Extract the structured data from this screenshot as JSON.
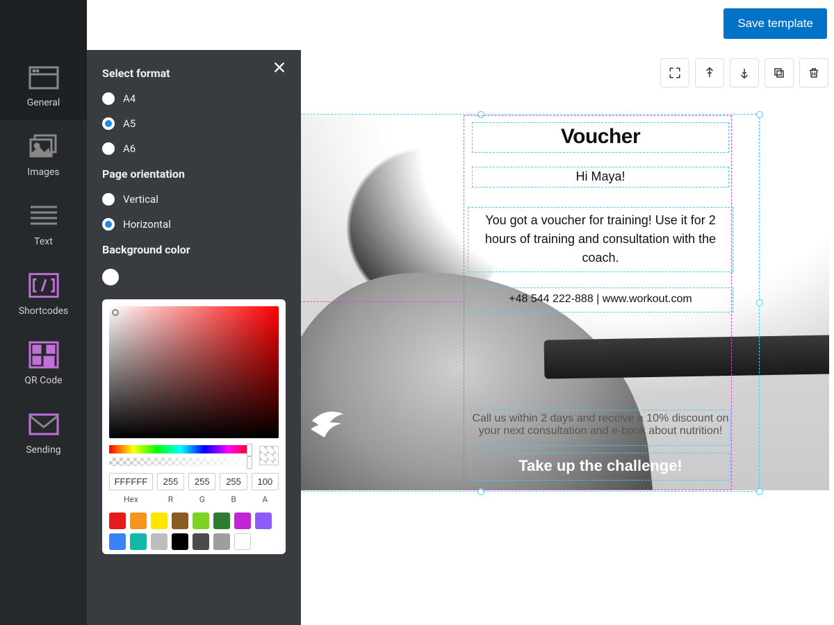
{
  "header": {
    "save_label": "Save template"
  },
  "sidebar": {
    "items": [
      {
        "label": "General"
      },
      {
        "label": "Images"
      },
      {
        "label": "Text"
      },
      {
        "label": "Shortcodes"
      },
      {
        "label": "QR Code"
      },
      {
        "label": "Sending"
      }
    ]
  },
  "panel": {
    "format_heading": "Select format",
    "formats": [
      "A4",
      "A5",
      "A6"
    ],
    "format_selected": "A5",
    "orientation_heading": "Page orientation",
    "orientations": [
      "Vertical",
      "Horizontal"
    ],
    "orientation_selected": "Horizontal",
    "bgcolor_heading": "Background color"
  },
  "color_picker": {
    "hex": "FFFFFF",
    "r": "255",
    "g": "255",
    "b": "255",
    "a": "100",
    "labels": {
      "hex": "Hex",
      "r": "R",
      "g": "G",
      "b": "B",
      "a": "A"
    },
    "swatches": [
      "#e41a1c",
      "#f7941d",
      "#ffe600",
      "#8a5a20",
      "#7ed321",
      "#2e7d32",
      "#c026d3",
      "#8b5cf6",
      "#3b82f6",
      "#14b8a6",
      "#bdbdbd",
      "#000000",
      "#4b4b4b",
      "#9e9e9e",
      "#ffffff"
    ]
  },
  "voucher": {
    "title": "Voucher",
    "greeting": "Hi Maya!",
    "desc": "You got a voucher for training! Use it for 2 hours of training and consultation with the coach.",
    "contact": "+48 544 222-888 | www.workout.com",
    "cta_top": "Call us within 2 days and receive a 10% discount on your next consultation and e-book about nutrition!",
    "cta": "Take up the challenge!"
  }
}
